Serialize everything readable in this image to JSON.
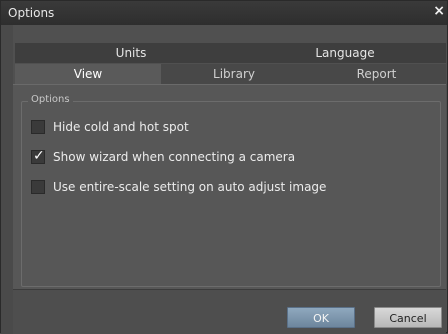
{
  "window": {
    "title": "Options",
    "close_glyph": "×"
  },
  "tabs": {
    "back_row": [
      {
        "label": "Units"
      },
      {
        "label": "Language"
      }
    ],
    "front_row": [
      {
        "label": "View",
        "active": true
      },
      {
        "label": "Library",
        "active": false
      },
      {
        "label": "Report",
        "active": false
      }
    ]
  },
  "panel": {
    "group_title": "Options",
    "options": [
      {
        "label": "Hide cold and hot spot",
        "checked": false
      },
      {
        "label": "Show wizard when connecting a camera",
        "checked": true
      },
      {
        "label": "Use entire-scale setting on auto adjust image",
        "checked": false
      }
    ]
  },
  "footer": {
    "ok_label": "OK",
    "cancel_label": "Cancel"
  },
  "colors": {
    "background": "#505050",
    "ok_accent": "#7d95ab"
  }
}
